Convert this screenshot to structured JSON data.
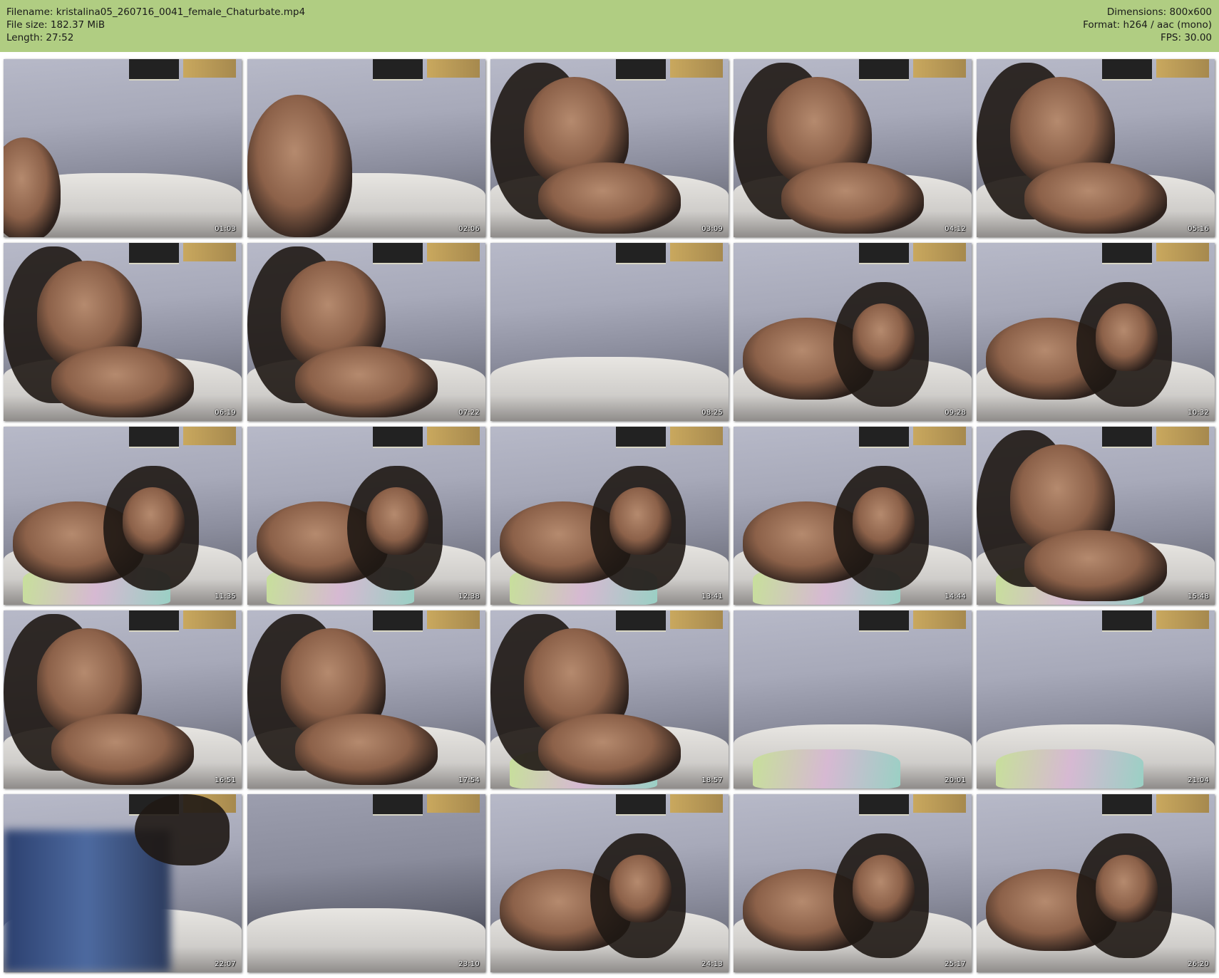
{
  "header": {
    "filename": "Filename: kristalina05_260716_0041_female_Chaturbate.mp4",
    "filesize": "File size: 182.37 MiB",
    "length": "Length: 27:52",
    "dimensions": "Dimensions: 800x600",
    "format": "Format: h264 / aac (mono)",
    "fps": "FPS: 30.00"
  },
  "colors": {
    "header_bg": "#b0cd82",
    "page_bg": "#ffffff"
  },
  "thumbnails": [
    {
      "timestamp": "01:03",
      "scene": "arm-edge"
    },
    {
      "timestamp": "02:06",
      "scene": "moving"
    },
    {
      "timestamp": "03:09",
      "scene": "face-close"
    },
    {
      "timestamp": "04:12",
      "scene": "face-close"
    },
    {
      "timestamp": "05:16",
      "scene": "face-hand"
    },
    {
      "timestamp": "06:19",
      "scene": "face-close"
    },
    {
      "timestamp": "07:22",
      "scene": "face-close"
    },
    {
      "timestamp": "08:25",
      "scene": "empty"
    },
    {
      "timestamp": "09:28",
      "scene": "lying"
    },
    {
      "timestamp": "10:32",
      "scene": "lying"
    },
    {
      "timestamp": "11:35",
      "scene": "lying-pillow"
    },
    {
      "timestamp": "12:38",
      "scene": "lying-pillow"
    },
    {
      "timestamp": "13:41",
      "scene": "lying-pillow"
    },
    {
      "timestamp": "14:44",
      "scene": "lying-pillow"
    },
    {
      "timestamp": "15:48",
      "scene": "face-hand-pillow"
    },
    {
      "timestamp": "16:51",
      "scene": "face-phone"
    },
    {
      "timestamp": "17:54",
      "scene": "face-phone"
    },
    {
      "timestamp": "18:57",
      "scene": "face-pillow"
    },
    {
      "timestamp": "20:01",
      "scene": "empty-pillow"
    },
    {
      "timestamp": "21:04",
      "scene": "empty-pillow"
    },
    {
      "timestamp": "22:07",
      "scene": "blur-jeans"
    },
    {
      "timestamp": "23:10",
      "scene": "empty-dark"
    },
    {
      "timestamp": "24:13",
      "scene": "lying-hand-head"
    },
    {
      "timestamp": "25:17",
      "scene": "lying-hand-head"
    },
    {
      "timestamp": "26:20",
      "scene": "lying"
    }
  ]
}
